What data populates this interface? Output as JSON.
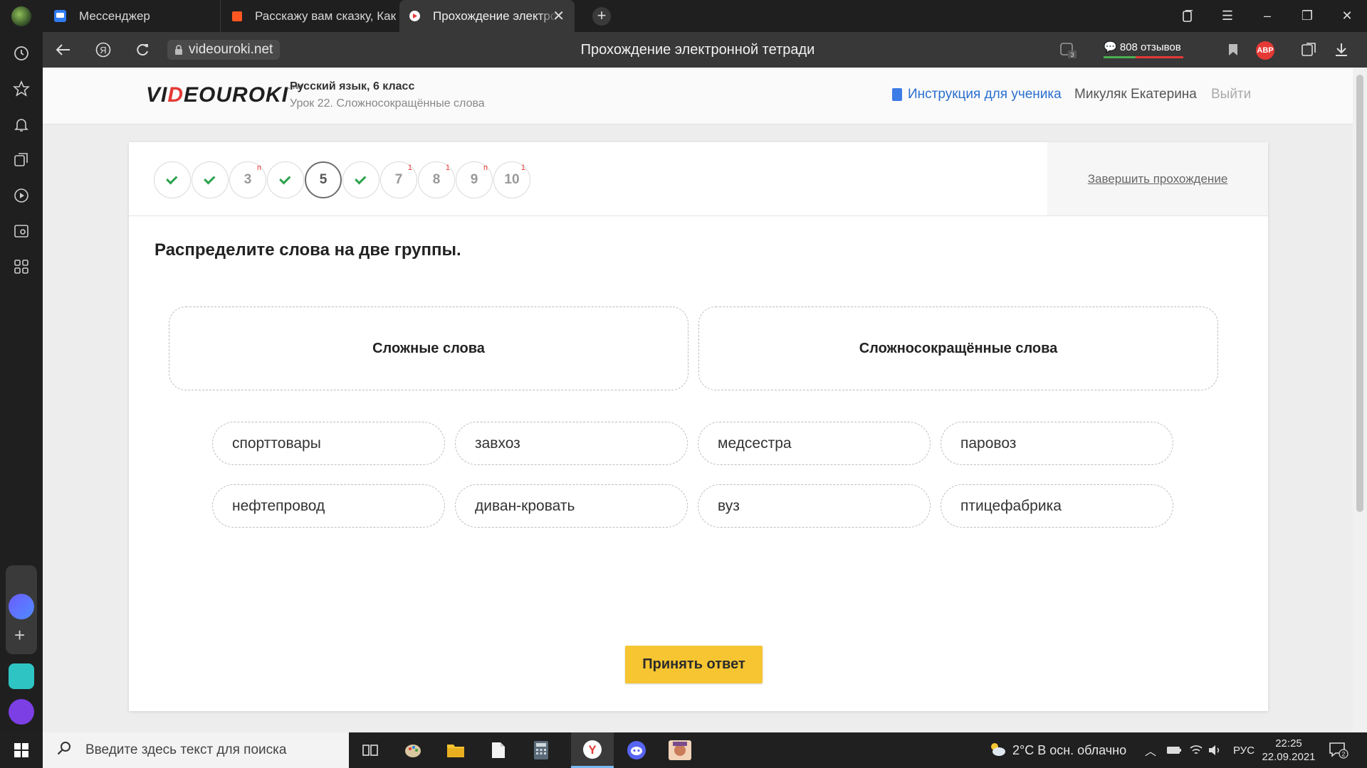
{
  "browser": {
    "tabs": [
      {
        "label": "Мессенджер",
        "icon": "messenger-icon",
        "active": false
      },
      {
        "label": "Расскажу вам сказку, Как",
        "icon": "orange-square-icon",
        "active": false
      },
      {
        "label": "Прохождение электронной тетради",
        "icon": "videouroki-play-icon",
        "active": true
      }
    ],
    "url": "videouroki.net",
    "page_title": "Прохождение электронной тетради",
    "reviews": "808 отзывов",
    "extension_badge": "3",
    "abp_label": "ABP"
  },
  "site": {
    "logo_text_a": "VI",
    "logo_text_o": "D",
    "logo_text_b": "EOUROKI",
    "logo_sub": ".net",
    "course_title": "Русский язык, 6 класс",
    "lesson_title": "Урок 22. Сложносокращённые слова",
    "instructions_link": "Инструкция для ученика",
    "user_name": "Микуляк Екатерина",
    "logout": "Выйти"
  },
  "steps": [
    {
      "label": "",
      "done": true,
      "mark": ""
    },
    {
      "label": "",
      "done": true,
      "mark": ""
    },
    {
      "label": "3",
      "done": false,
      "mark": "п"
    },
    {
      "label": "",
      "done": true,
      "mark": ""
    },
    {
      "label": "5",
      "done": false,
      "mark": "",
      "current": true
    },
    {
      "label": "",
      "done": true,
      "mark": ""
    },
    {
      "label": "7",
      "done": false,
      "mark": "1"
    },
    {
      "label": "8",
      "done": false,
      "mark": "1"
    },
    {
      "label": "9",
      "done": false,
      "mark": "п"
    },
    {
      "label": "10",
      "done": false,
      "mark": "1"
    }
  ],
  "finish_link": "Завершить прохождение",
  "task": {
    "question": "Распределите слова на две группы.",
    "groups": [
      "Сложные слова",
      "Сложносокращённые слова"
    ],
    "words": [
      "спорттовары",
      "завхоз",
      "медсестра",
      "паровоз",
      "нефтепровод",
      "диван-кровать",
      "вуз",
      "птицефабрика"
    ],
    "submit": "Принять ответ"
  },
  "taskbar": {
    "search_placeholder": "Введите здесь текст для поиска",
    "weather": "2°C  В осн. облачно",
    "language": "РУС",
    "time": "22:25",
    "date": "22.09.2021",
    "notifications": "2"
  }
}
